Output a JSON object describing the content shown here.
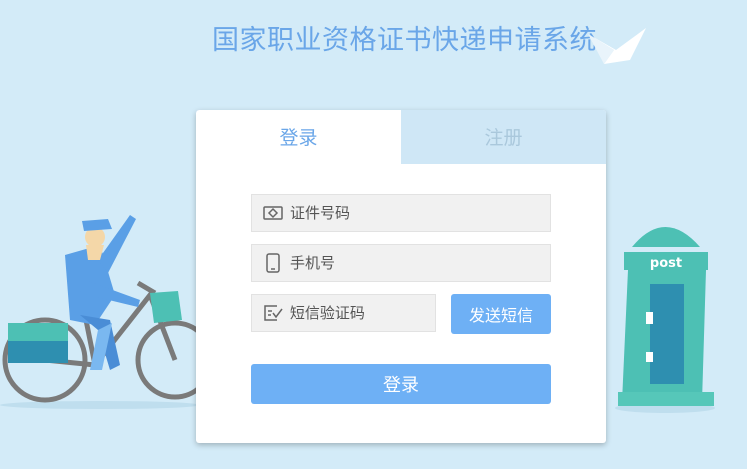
{
  "title": "国家职业资格证书快递申请系统",
  "tabs": {
    "login": "登录",
    "register": "注册"
  },
  "form": {
    "id_placeholder": "证件号码",
    "phone_placeholder": "手机号",
    "code_placeholder": "短信验证码",
    "send_sms": "发送短信",
    "submit": "登录"
  },
  "decor": {
    "mailbox_text": "post"
  },
  "colors": {
    "background": "#d3ebf8",
    "accent": "#6eb0f5",
    "title": "#6aa6e8",
    "teal": "#4dc0b4"
  }
}
